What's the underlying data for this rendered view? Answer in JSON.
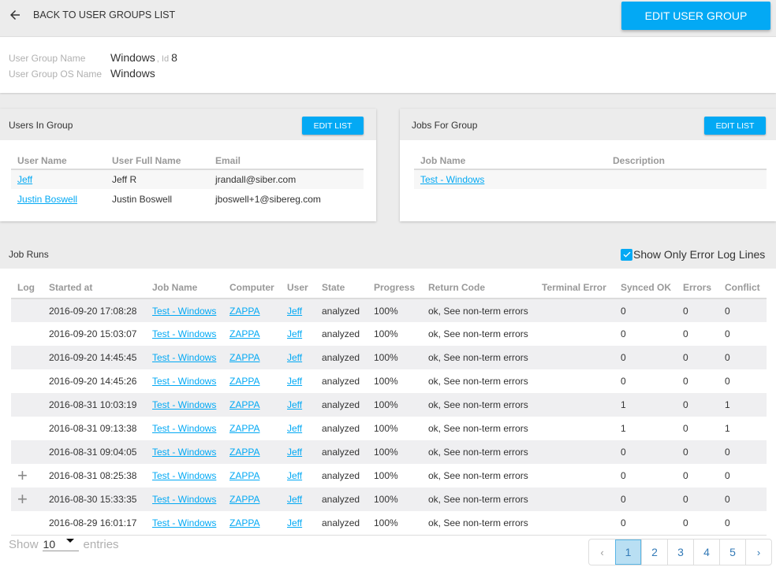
{
  "header": {
    "back_label": "BACK TO USER GROUPS LIST",
    "edit_button": "EDIT USER GROUP"
  },
  "group_info": {
    "name_label": "User Group Name",
    "name_value": "Windows",
    "id_label": ", Id",
    "id_value": "8",
    "os_label": "User Group OS Name",
    "os_value": "Windows"
  },
  "users_card": {
    "title": "Users In Group",
    "edit_button": "EDIT LIST",
    "columns": [
      "User Name",
      "User Full Name",
      "Email"
    ],
    "rows": [
      {
        "user_name": "Jeff",
        "full_name": "Jeff R",
        "email": "jrandall@siber.com"
      },
      {
        "user_name": "Justin Boswell",
        "full_name": "Justin Boswell",
        "email": "jboswell+1@sibereg.com"
      }
    ]
  },
  "jobs_card": {
    "title": "Jobs For Group",
    "edit_button": "EDIT LIST",
    "columns": [
      "Job Name",
      "Description"
    ],
    "rows": [
      {
        "job_name": "Test - Windows",
        "description": ""
      }
    ]
  },
  "job_runs": {
    "title": "Job Runs",
    "error_filter_label": "Show Only Error Log Lines",
    "error_filter_checked": true,
    "columns": [
      "Log",
      "Started at",
      "Job Name",
      "Computer",
      "User",
      "State",
      "Progress",
      "Return Code",
      "Terminal Error",
      "Synced OK",
      "Errors",
      "Conflict"
    ],
    "rows": [
      {
        "log": "",
        "started": "2016-09-20 17:08:28",
        "job": "Test - Windows",
        "computer": "ZAPPA",
        "user": "Jeff",
        "state": "analyzed",
        "progress": "100%",
        "return_code": "ok, See non-term errors",
        "terminal_error": "",
        "synced_ok": "0",
        "errors": "0",
        "conflict": "0"
      },
      {
        "log": "",
        "started": "2016-09-20 15:03:07",
        "job": "Test - Windows",
        "computer": "ZAPPA",
        "user": "Jeff",
        "state": "analyzed",
        "progress": "100%",
        "return_code": "ok, See non-term errors",
        "terminal_error": "",
        "synced_ok": "0",
        "errors": "0",
        "conflict": "0"
      },
      {
        "log": "",
        "started": "2016-09-20 14:45:45",
        "job": "Test - Windows",
        "computer": "ZAPPA",
        "user": "Jeff",
        "state": "analyzed",
        "progress": "100%",
        "return_code": "ok, See non-term errors",
        "terminal_error": "",
        "synced_ok": "0",
        "errors": "0",
        "conflict": "0"
      },
      {
        "log": "",
        "started": "2016-09-20 14:45:26",
        "job": "Test - Windows",
        "computer": "ZAPPA",
        "user": "Jeff",
        "state": "analyzed",
        "progress": "100%",
        "return_code": "ok, See non-term errors",
        "terminal_error": "",
        "synced_ok": "0",
        "errors": "0",
        "conflict": "0"
      },
      {
        "log": "",
        "started": "2016-08-31 10:03:19",
        "job": "Test - Windows",
        "computer": "ZAPPA",
        "user": "Jeff",
        "state": "analyzed",
        "progress": "100%",
        "return_code": "ok, See non-term errors",
        "terminal_error": "",
        "synced_ok": "1",
        "errors": "0",
        "conflict": "1"
      },
      {
        "log": "",
        "started": "2016-08-31 09:13:38",
        "job": "Test - Windows",
        "computer": "ZAPPA",
        "user": "Jeff",
        "state": "analyzed",
        "progress": "100%",
        "return_code": "ok, See non-term errors",
        "terminal_error": "",
        "synced_ok": "1",
        "errors": "0",
        "conflict": "1"
      },
      {
        "log": "",
        "started": "2016-08-31 09:04:05",
        "job": "Test - Windows",
        "computer": "ZAPPA",
        "user": "Jeff",
        "state": "analyzed",
        "progress": "100%",
        "return_code": "ok, See non-term errors",
        "terminal_error": "",
        "synced_ok": "0",
        "errors": "0",
        "conflict": "0"
      },
      {
        "log": "+",
        "started": "2016-08-31 08:25:38",
        "job": "Test - Windows",
        "computer": "ZAPPA",
        "user": "Jeff",
        "state": "analyzed",
        "progress": "100%",
        "return_code": "ok, See non-term errors",
        "terminal_error": "",
        "synced_ok": "0",
        "errors": "0",
        "conflict": "0"
      },
      {
        "log": "+",
        "started": "2016-08-30 15:33:35",
        "job": "Test - Windows",
        "computer": "ZAPPA",
        "user": "Jeff",
        "state": "analyzed",
        "progress": "100%",
        "return_code": "ok, See non-term errors",
        "terminal_error": "",
        "synced_ok": "0",
        "errors": "0",
        "conflict": "0"
      },
      {
        "log": "",
        "started": "2016-08-29 16:01:17",
        "job": "Test - Windows",
        "computer": "ZAPPA",
        "user": "Jeff",
        "state": "analyzed",
        "progress": "100%",
        "return_code": "ok, See non-term errors",
        "terminal_error": "",
        "synced_ok": "0",
        "errors": "0",
        "conflict": "0"
      }
    ]
  },
  "footer": {
    "show_label": "Show",
    "page_size": "10",
    "entries_label": "entries",
    "pagination": {
      "prev": "‹",
      "pages": [
        "1",
        "2",
        "3",
        "4",
        "5"
      ],
      "current": "1",
      "next": "›"
    }
  },
  "colors": {
    "accent": "#03a9f4",
    "header_bg": "#ececec",
    "label_gray": "#b0b0b0",
    "active_page_bg": "#b9dff3"
  }
}
